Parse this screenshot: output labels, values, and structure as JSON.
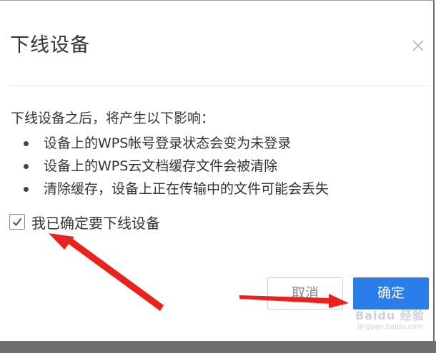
{
  "dialog": {
    "title": "下线设备",
    "close_icon": "close-icon",
    "intro": "下线设备之后，将产生以下影响：",
    "bullets": [
      "设备上的WPS帐号登录状态会变为未登录",
      "设备上的WPS云文档缓存文件会被清除",
      "清除缓存，设备上正在传输中的文件可能会丢失"
    ],
    "confirm_checkbox": {
      "label": "我已确定要下线设备",
      "checked": true
    },
    "cancel_label": "取消",
    "ok_label": "确定"
  },
  "watermark": {
    "text": "Baidu 经验",
    "sub": "jingyan.baidu.com"
  },
  "colors": {
    "primary": "#2b7de9",
    "annotation_arrow": "#e8231e",
    "text": "#333333"
  }
}
